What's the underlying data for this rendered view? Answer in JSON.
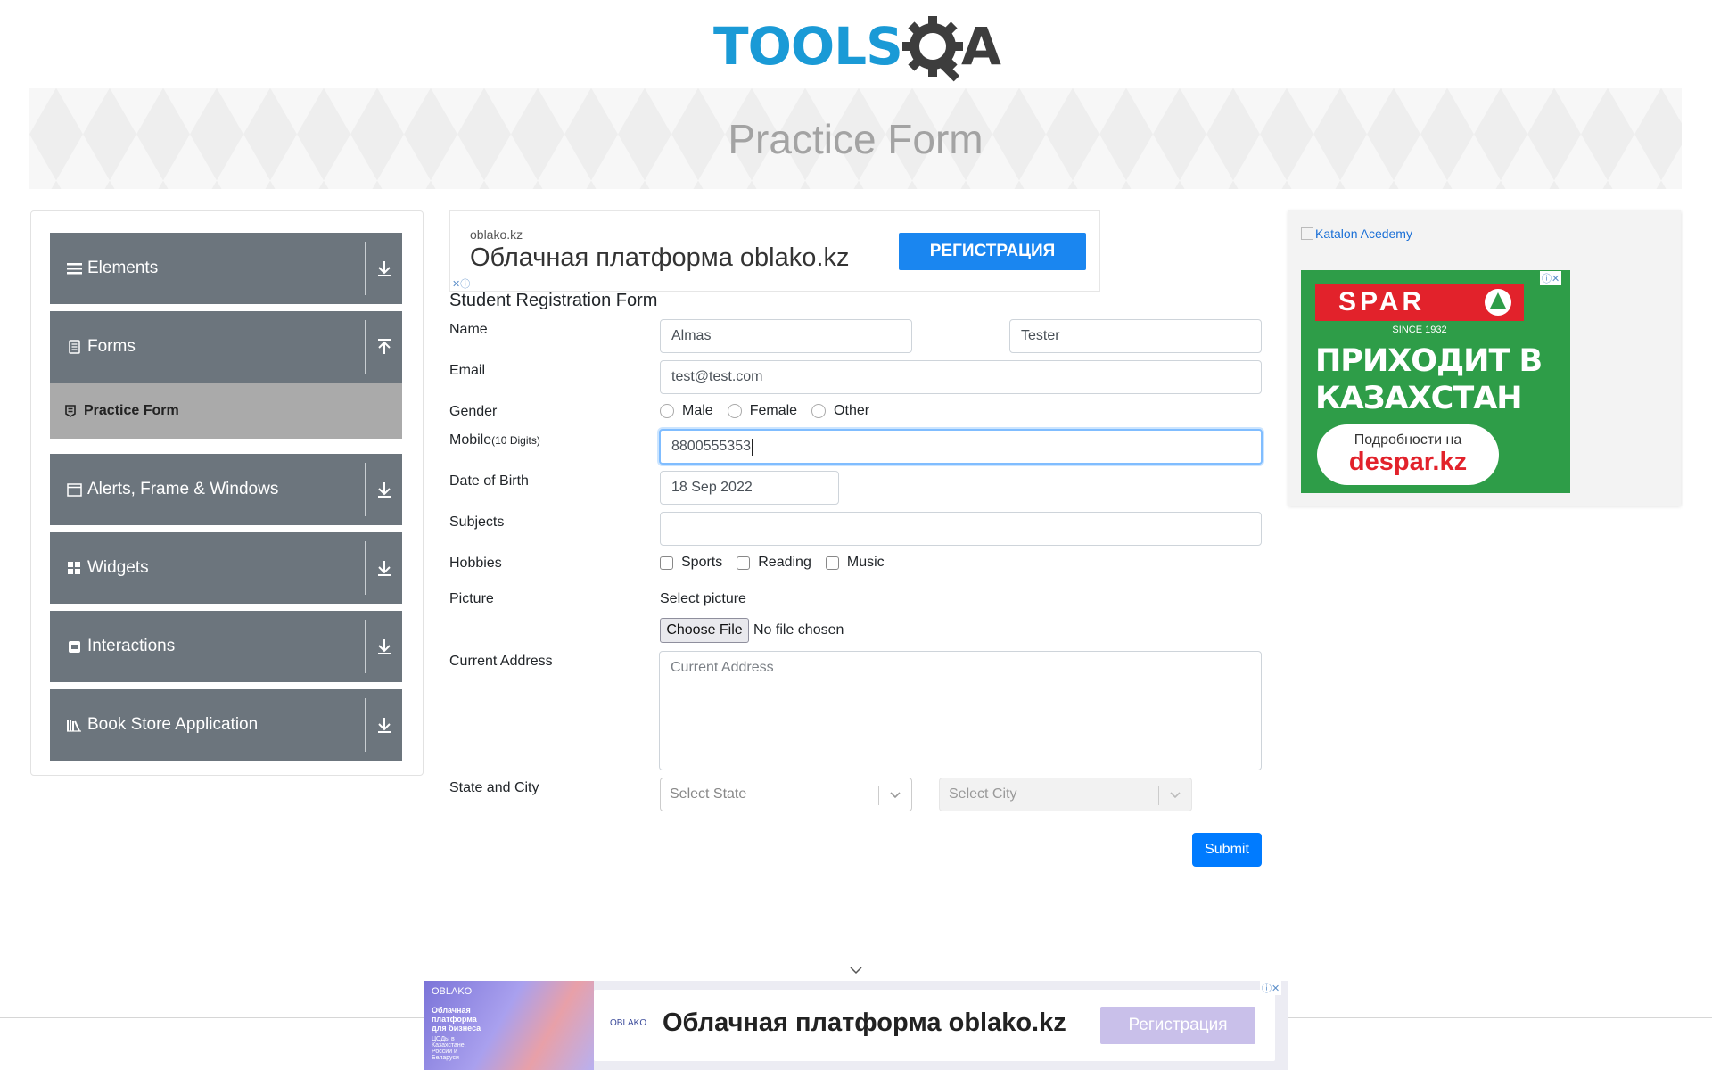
{
  "logo": {
    "text": "TOOLS",
    "suffix": "A"
  },
  "banner": {
    "title": "Practice Form"
  },
  "nav": {
    "groups": [
      {
        "label": "Elements",
        "icon": "hamburger-icon"
      },
      {
        "label": "Forms",
        "icon": "document-icon"
      },
      {
        "label": "Alerts, Frame & Windows",
        "icon": "window-icon"
      },
      {
        "label": "Widgets",
        "icon": "widgets-icon"
      },
      {
        "label": "Interactions",
        "icon": "interactions-icon"
      },
      {
        "label": "Book Store Application",
        "icon": "books-icon"
      }
    ],
    "active_item": "Practice Form"
  },
  "ad_top": {
    "source": "oblako.kz",
    "headline": "Облачная платформа oblako.kz",
    "cta": "РЕГИСТРАЦИЯ"
  },
  "form": {
    "title": "Student Registration Form",
    "labels": {
      "name": "Name",
      "email": "Email",
      "gender": "Gender",
      "mobile": "Mobile",
      "mobile_hint": "(10 Digits)",
      "dob": "Date of Birth",
      "subjects": "Subjects",
      "hobbies": "Hobbies",
      "picture": "Picture",
      "address": "Current Address",
      "state_city": "State and City"
    },
    "first_name": "Almas",
    "last_name": "Tester",
    "email": "test@test.com",
    "genders": [
      "Male",
      "Female",
      "Other"
    ],
    "mobile": "8800555353",
    "dob": "18 Sep 2022",
    "subjects": "",
    "hobbies": [
      "Sports",
      "Reading",
      "Music"
    ],
    "picture_label": "Select picture",
    "file_button": "Choose File",
    "file_status": "No file chosen",
    "address_placeholder": "Current Address",
    "state_placeholder": "Select State",
    "city_placeholder": "Select City",
    "submit": "Submit"
  },
  "ad_right": {
    "katalon": "Katalon Acedemy",
    "brand": "SPAR",
    "since": "SINCE 1932",
    "line1": "ПРИХОДИТ В",
    "line2": "КАЗАХСТАН",
    "details": "Подробности на",
    "site": "despar.kz"
  },
  "ad_bottom": {
    "thumb_brand": "OBLAKO",
    "thumb_text": "Облачная платформа для бизнеса",
    "thumb_sub": "ЦОДы в Казахстане, России и Беларуси",
    "mini_brand": "OBLAKO",
    "headline": "Облачная платформа oblako.kz",
    "cta": "Регистрация"
  },
  "colors": {
    "nav_group": "#6c757d",
    "nav_active": "#aaaaaa",
    "primary": "#007bff",
    "logo_blue": "#1a9ad6",
    "spar_green": "#2e9d48",
    "spar_red": "#e2222b"
  }
}
